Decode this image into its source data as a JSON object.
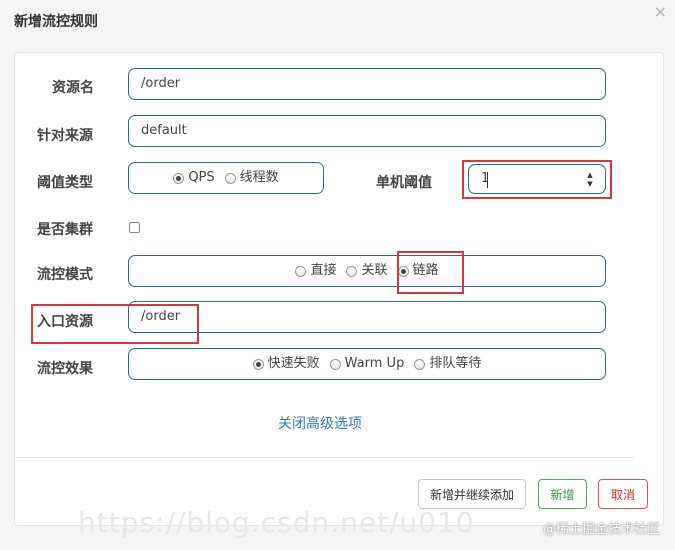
{
  "dialog": {
    "title": "新增流控规则",
    "close_glyph": "×"
  },
  "form": {
    "resource_name": {
      "label": "资源名",
      "value": "/order"
    },
    "limit_app": {
      "label": "针对来源",
      "value": "default"
    },
    "grade": {
      "label": "阈值类型",
      "options": [
        "QPS",
        "线程数"
      ],
      "selected": "QPS"
    },
    "threshold": {
      "label": "单机阈值",
      "value": "1"
    },
    "cluster": {
      "label": "是否集群",
      "checked": false
    },
    "strategy": {
      "label": "流控模式",
      "options": [
        "直接",
        "关联",
        "链路"
      ],
      "selected": "链路"
    },
    "ref_resource": {
      "label": "入口资源",
      "value": "/order"
    },
    "control_behavior": {
      "label": "流控效果",
      "options": [
        "快速失败",
        "Warm Up",
        "排队等待"
      ],
      "selected": "快速失败"
    }
  },
  "advanced_toggle": "关闭高级选项",
  "footer": {
    "save_and_continue": "新增并继续添加",
    "save": "新增",
    "cancel": "取消"
  },
  "watermark": {
    "url": "https://blog.csdn.net/u010",
    "site": "@稀土掘金技术社区"
  },
  "colors": {
    "field_border": "#2d6a91",
    "highlight_box": "#d9363e",
    "link": "#2f7cb6",
    "success": "#2e9a3f",
    "danger": "#c9302c"
  }
}
